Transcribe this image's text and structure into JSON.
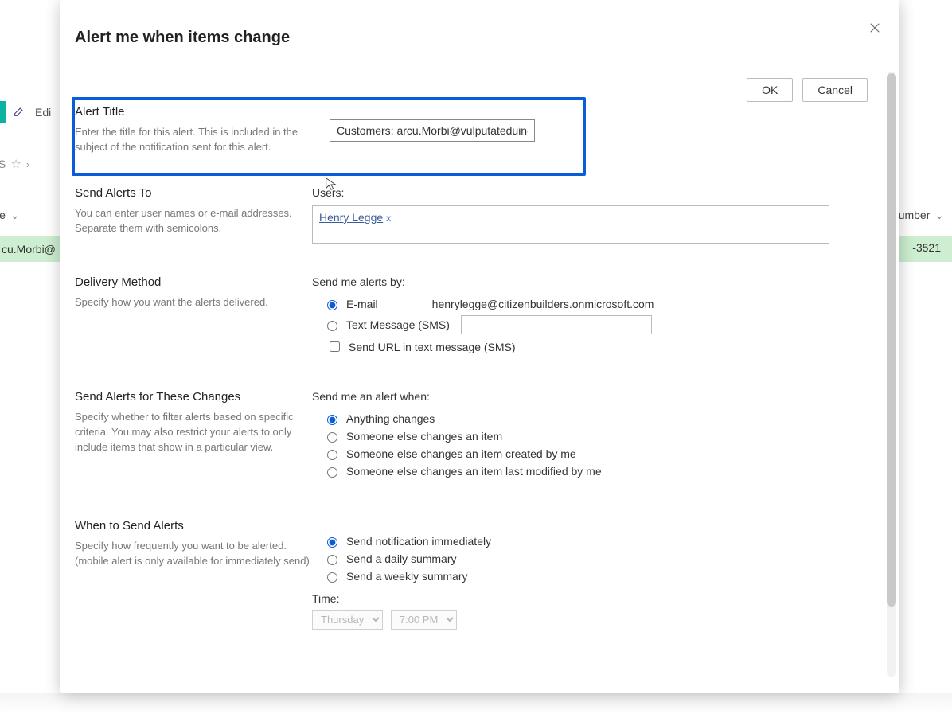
{
  "background": {
    "edit_label": "Edi",
    "star_row_suffix": "S",
    "col_le": "le",
    "row_email_fragment": "cu.Morbi@",
    "col_number": "umber",
    "row_phone_fragment": "-3521"
  },
  "dialog": {
    "title": "Alert me when items change",
    "buttons": {
      "ok": "OK",
      "cancel": "Cancel"
    },
    "sections": {
      "alert_title": {
        "heading": "Alert Title",
        "desc": "Enter the title for this alert. This is included in the subject of the notification sent for this alert.",
        "value": "Customers: arcu.Morbi@vulputateduinec."
      },
      "send_to": {
        "heading": "Send Alerts To",
        "desc": "You can enter user names or e-mail addresses. Separate them with semicolons.",
        "users_label": "Users:",
        "user_name": "Henry Legge",
        "remove_glyph": "x"
      },
      "delivery": {
        "heading": "Delivery Method",
        "desc": "Specify how you want the alerts delivered.",
        "send_by_label": "Send me alerts by:",
        "email_label": "E-mail",
        "email_address": "henrylegge@citizenbuilders.onmicrosoft.com",
        "sms_label": "Text Message (SMS)",
        "sms_url_label": "Send URL in text message (SMS)"
      },
      "changes": {
        "heading": "Send Alerts for These Changes",
        "desc": "Specify whether to filter alerts based on specific criteria. You may also restrict your alerts to only include items that show in a particular view.",
        "prompt": "Send me an alert when:",
        "options": [
          "Anything changes",
          "Someone else changes an item",
          "Someone else changes an item created by me",
          "Someone else changes an item last modified by me"
        ]
      },
      "when": {
        "heading": "When to Send Alerts",
        "desc": "Specify how frequently you want to be alerted. (mobile alert is only available for immediately send)",
        "options": [
          "Send notification immediately",
          "Send a daily summary",
          "Send a weekly summary"
        ],
        "time_label": "Time:",
        "day_value": "Thursday",
        "hour_value": "7:00 PM"
      }
    }
  }
}
